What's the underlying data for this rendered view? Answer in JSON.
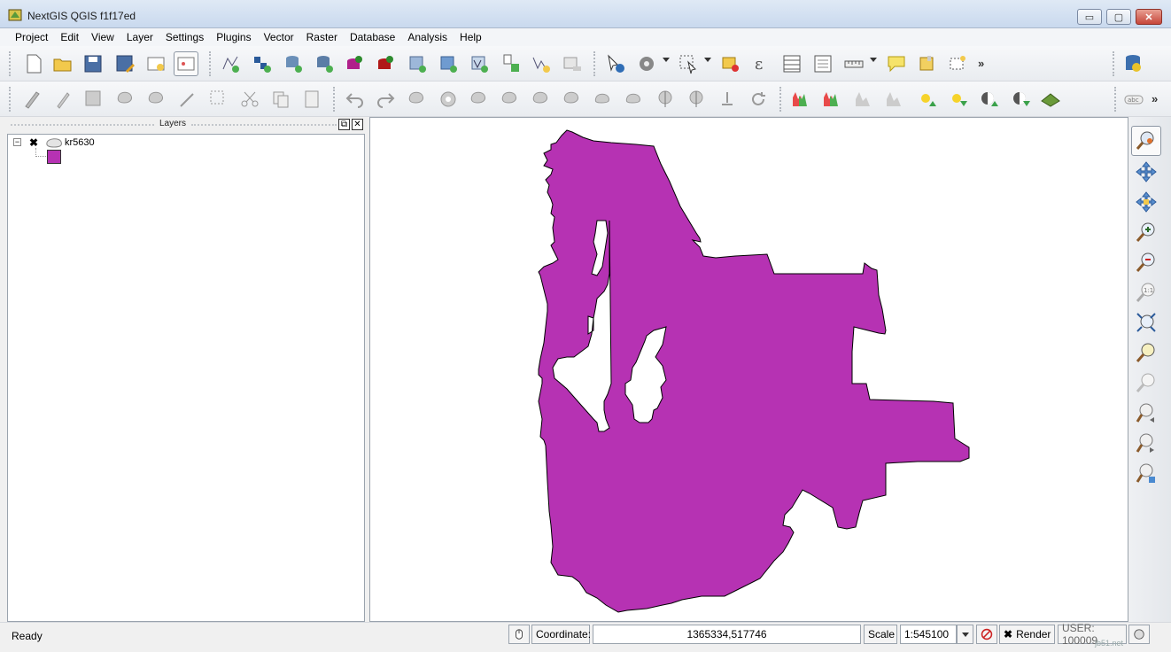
{
  "window": {
    "title": "NextGIS QGIS f1f17ed",
    "buttons": {
      "minimize": "▭",
      "maximize": "▢",
      "close": "✕"
    }
  },
  "menubar": {
    "items": [
      "Project",
      "Edit",
      "View",
      "Layer",
      "Settings",
      "Plugins",
      "Vector",
      "Raster",
      "Database",
      "Analysis",
      "Help"
    ]
  },
  "toolbars": {
    "overflow_glyph": "»"
  },
  "layers_panel": {
    "title": "Layers",
    "float_glyph": "⧉",
    "close_glyph": "✕",
    "expander_glyph": "−",
    "layer": {
      "name": "kr5630",
      "visible_glyph": "✖"
    },
    "fill_color": "#b632b3"
  },
  "map": {
    "background": "#ffffff",
    "polygon_fill": "#b632b3",
    "polygon_stroke": "#000000"
  },
  "statusbar": {
    "status": "Ready",
    "coordinate_label": "Coordinate:",
    "coordinate_value": "1365334,517746",
    "scale_label": "Scale",
    "scale_value": "1:545100",
    "render_label": "Render",
    "render_checked_glyph": "✖",
    "user_text": "USER: 100009",
    "watermark": "jb51.net"
  }
}
